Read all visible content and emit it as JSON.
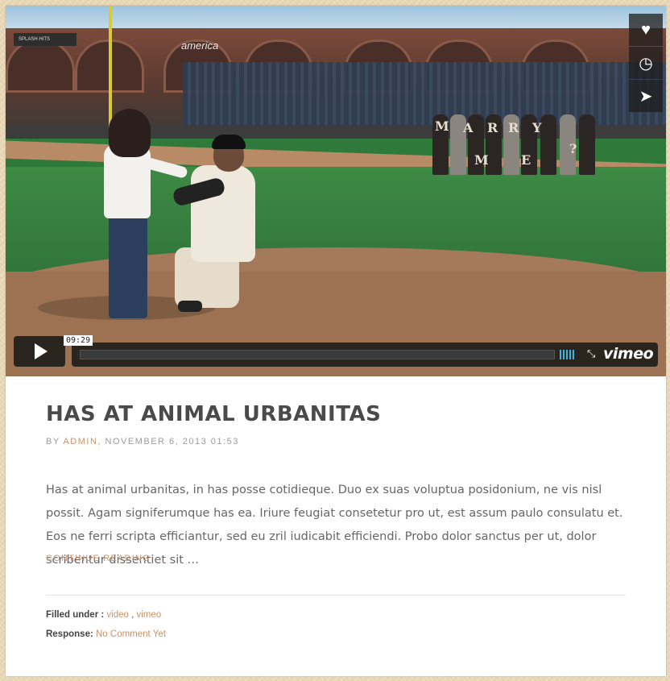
{
  "video": {
    "time_badge": "09:29",
    "logo": "vimeo",
    "scene_sign": "america",
    "scene_sign_left": "SPLASH HITS",
    "scene_letters": [
      "M",
      "A",
      "R",
      "R",
      "Y",
      "M",
      "E",
      "?"
    ],
    "side_actions": [
      {
        "icon": "heart-icon",
        "glyph": "♥"
      },
      {
        "icon": "clock-icon",
        "glyph": "◷"
      },
      {
        "icon": "paper-plane-icon",
        "glyph": "➤"
      }
    ],
    "play_icon": "play-icon",
    "fullscreen_glyph": "⤡",
    "volume_color": "#3fb4e0"
  },
  "post": {
    "title": "HAS AT ANIMAL URBANITAS",
    "meta": {
      "by": "BY",
      "author": "ADMIN",
      "separator": ",",
      "date": "NOVEMBER 6, 2013 01:53"
    },
    "excerpt": "Has at animal urbanitas, in has posse cotidieque. Duo ex suas voluptua posidonium, ne vis nisl possit. Agam signiferumque has ea. Iriure feugiat consetetur pro ut, est assum paulo consulatu et. Eos ne ferri scripta efficiantur, sed eu zril iudicabit efficiendi. Probo dolor sanctus per ut, dolor scribentur dissentiet sit …",
    "continue_label": "CONTINUE READING →",
    "filed_label": "Filled under :",
    "tags": [
      "video",
      "vimeo"
    ],
    "tag_separator": " , ",
    "response_label": "Response:",
    "response_value": "No Comment Yet"
  },
  "colors": {
    "accent": "#c9936a",
    "background": "#ecd9b6",
    "title": "#4a4a4a"
  }
}
